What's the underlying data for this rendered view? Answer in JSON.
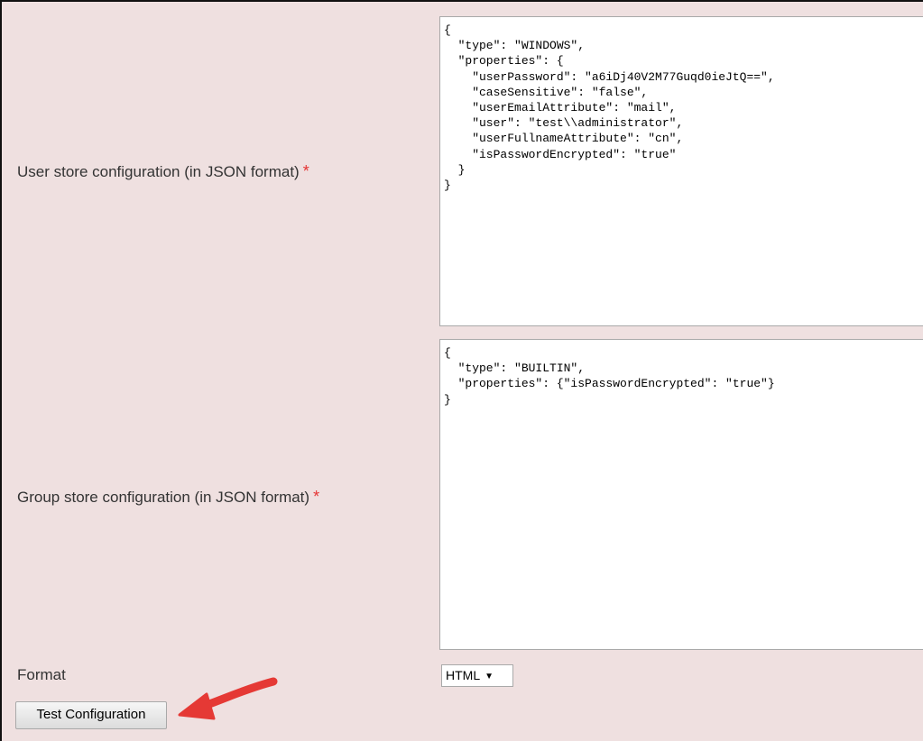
{
  "user_store": {
    "label": "User store configuration (in JSON format)",
    "required_mark": "*",
    "value": "{\n  \"type\": \"WINDOWS\",\n  \"properties\": {\n    \"userPassword\": \"a6iDj40V2M77Guqd0ieJtQ==\",\n    \"caseSensitive\": \"false\",\n    \"userEmailAttribute\": \"mail\",\n    \"user\": \"test\\\\administrator\",\n    \"userFullnameAttribute\": \"cn\",\n    \"isPasswordEncrypted\": \"true\"\n  }\n}"
  },
  "group_store": {
    "label": "Group store configuration (in JSON format)",
    "required_mark": "*",
    "value": "{\n  \"type\": \"BUILTIN\",\n  \"properties\": {\"isPasswordEncrypted\": \"true\"}\n}"
  },
  "format": {
    "label": "Format",
    "selected": "HTML",
    "caret": "▼"
  },
  "test_button": {
    "label": "Test Configuration"
  },
  "colors": {
    "background": "#efe0e0",
    "required": "#e53333",
    "arrow": "#e53935"
  },
  "annotations": {
    "arrow_icon": "red-arrow-pointing-left"
  }
}
